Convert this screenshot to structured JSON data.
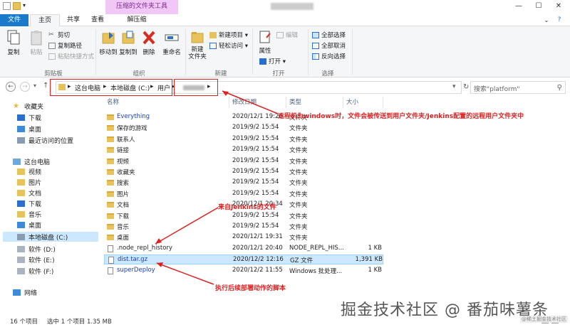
{
  "window": {
    "context_tab": "压缩的文件夹工具",
    "controls": [
      "—",
      "☐",
      "✕"
    ]
  },
  "tabs": {
    "file": "文件",
    "home": "主页",
    "share": "共享",
    "view": "查看",
    "extract": "解压缩"
  },
  "ribbon": {
    "copy": "复制",
    "paste": "粘贴",
    "cut": "剪切",
    "copy_path": "复制路径",
    "paste_shortcut": "粘贴快捷方式",
    "move_to": "移动到",
    "copy_to": "复制到",
    "delete": "删除",
    "rename": "重命名",
    "new_folder": "新建\n文件夹",
    "new_item": "新建项目 ▾",
    "easy_access": "轻松访问 ▾",
    "properties": "属性",
    "open": "打开 ▾",
    "edit": "编辑",
    "select_all": "全部选择",
    "select_none": "全部取消",
    "invert": "反向选择",
    "groups": {
      "clipboard": "剪贴板",
      "organize": "组织",
      "new": "新建",
      "open": "打开",
      "select": "选择"
    }
  },
  "address": {
    "crumbs": [
      "这台电脑",
      "本地磁盘 (C:)",
      "用户"
    ],
    "search_placeholder": "搜索\"platform\""
  },
  "nav": {
    "favorites": "收藏夹",
    "downloads": "下载",
    "desktop": "桌面",
    "recent": "最近访问的位置",
    "this_pc": "这台电脑",
    "videos": "视频",
    "pictures": "图片",
    "documents": "文档",
    "downloads2": "下载",
    "music": "音乐",
    "desktop2": "桌面",
    "local_c": "本地磁盘 (C:)",
    "soft_d": "软件 (D:)",
    "soft_e": "软件 (E:)",
    "soft_f": "软件 (F:)",
    "network": "网络"
  },
  "columns": {
    "name": "名称",
    "date": "修改日期",
    "type": "类型",
    "size": "大小"
  },
  "files": [
    {
      "name": "Everything",
      "date": "2020/12/1 19:26",
      "type": "文件夹",
      "size": "",
      "kind": "folder",
      "highlight": true
    },
    {
      "name": "保存的游戏",
      "date": "2019/9/2 15:54",
      "type": "文件夹",
      "size": "",
      "kind": "folder"
    },
    {
      "name": "联系人",
      "date": "2019/9/2 15:54",
      "type": "文件夹",
      "size": "",
      "kind": "folder"
    },
    {
      "name": "链接",
      "date": "2019/9/2 15:54",
      "type": "文件夹",
      "size": "",
      "kind": "folder"
    },
    {
      "name": "视频",
      "date": "2019/9/2 15:54",
      "type": "文件夹",
      "size": "",
      "kind": "folder"
    },
    {
      "name": "收藏夹",
      "date": "2019/9/2 15:54",
      "type": "文件夹",
      "size": "",
      "kind": "folder"
    },
    {
      "name": "搜索",
      "date": "2019/9/2 15:54",
      "type": "文件夹",
      "size": "",
      "kind": "folder"
    },
    {
      "name": "图片",
      "date": "2019/9/2 15:54",
      "type": "文件夹",
      "size": "",
      "kind": "folder"
    },
    {
      "name": "文档",
      "date": "2020/12/1 20:34",
      "type": "文件夹",
      "size": "",
      "kind": "folder"
    },
    {
      "name": "下载",
      "date": "2019/9/2 15:54",
      "type": "文件夹",
      "size": "",
      "kind": "folder"
    },
    {
      "name": "音乐",
      "date": "2019/9/2 15:54",
      "type": "文件夹",
      "size": "",
      "kind": "folder"
    },
    {
      "name": "桌面",
      "date": "2020/12/1 19:31",
      "type": "文件夹",
      "size": "",
      "kind": "folder"
    },
    {
      "name": ".node_repl_history",
      "date": "2020/12/1 20:40",
      "type": "NODE_REPL_HIS...",
      "size": "1 KB",
      "kind": "file"
    },
    {
      "name": "dist.tar.gz",
      "date": "2020/12/2 12:16",
      "type": "GZ 文件",
      "size": "1,391 KB",
      "kind": "file",
      "selected": true,
      "highlight": true
    },
    {
      "name": "superDeploy",
      "date": "2020/12/2 11:55",
      "type": "Windows 批处理...",
      "size": "1 KB",
      "kind": "file",
      "highlight": true
    }
  ],
  "annotations": {
    "top": "远程机为windows时，文件会被传送到用户文件夹/Jenkins配置的远程用户文件夹中",
    "middle": "来自Jenkins的文件",
    "bottom": "执行后续部署动作的脚本"
  },
  "status": {
    "count": "16 个项目",
    "selected": "选中 1 个项目  1.35 MB"
  },
  "watermark": {
    "main": "掘金技术社区 @ 番茄味薯条",
    "small": "@稀土掘金技术社区"
  }
}
